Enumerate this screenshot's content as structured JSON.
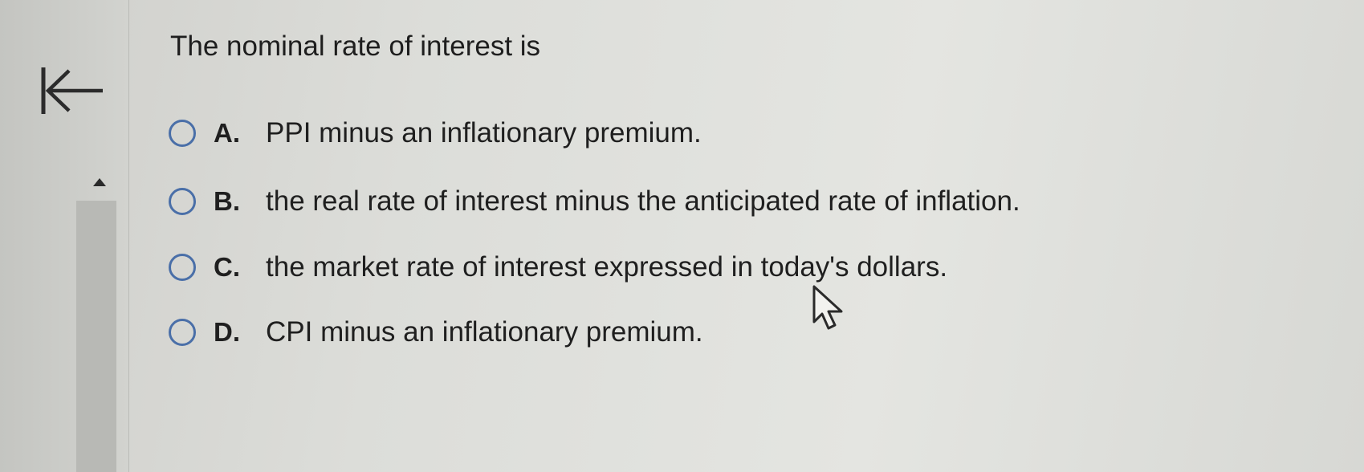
{
  "question": {
    "text": "The nominal rate of interest is"
  },
  "options": [
    {
      "letter": "A.",
      "text": "PPI minus an inflationary premium.",
      "selected": false
    },
    {
      "letter": "B.",
      "text": "the real rate of interest minus the anticipated rate of inflation.",
      "selected": false
    },
    {
      "letter": "C.",
      "text": "the market rate of interest expressed in today's dollars.",
      "selected": false
    },
    {
      "letter": "D.",
      "text": "CPI minus an inflationary premium.",
      "selected": false
    }
  ],
  "icons": {
    "collapse": "collapse-left-icon",
    "scroll_up": "triangle-up-icon",
    "cursor": "mouse-pointer-icon"
  },
  "colors": {
    "radio_border": "#4a6fa8",
    "text": "#1f1f1f"
  }
}
